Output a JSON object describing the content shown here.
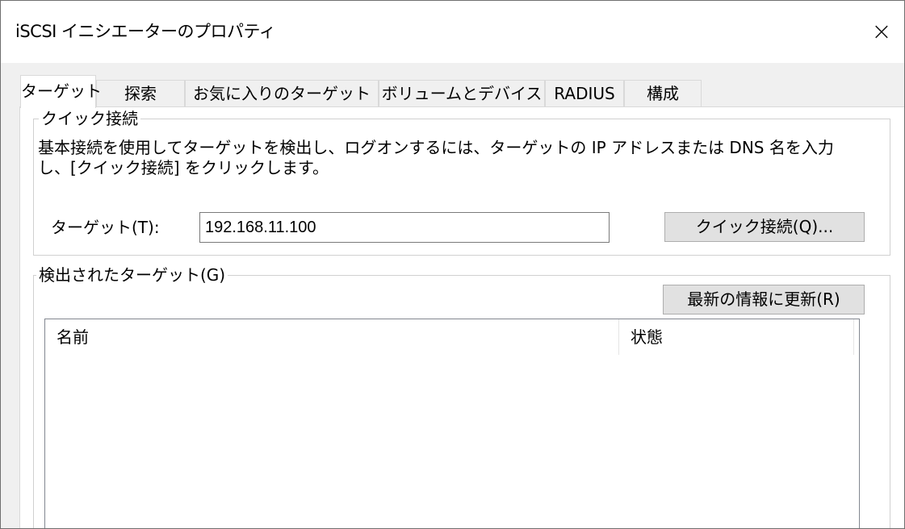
{
  "window": {
    "title": "iSCSI イニシエーターのプロパティ",
    "close_label": "×"
  },
  "tabs": [
    {
      "label": "ターゲット",
      "active": true
    },
    {
      "label": "探索",
      "active": false
    },
    {
      "label": "お気に入りのターゲット",
      "active": false
    },
    {
      "label": "ボリュームとデバイス",
      "active": false
    },
    {
      "label": "RADIUS",
      "active": false
    },
    {
      "label": "構成",
      "active": false
    }
  ],
  "quick_connect": {
    "legend": "クイック接続",
    "description": "基本接続を使用してターゲットを検出し、ログオンするには、ターゲットの IP アドレスまたは DNS 名を入力\nし、[クイック接続] をクリックします。",
    "target_label": "ターゲット(T):",
    "target_value": "192.168.11.100",
    "button_label": "クイック接続(Q)..."
  },
  "discovered_targets": {
    "legend": "検出されたターゲット(G)",
    "refresh_button": "最新の情報に更新(R)",
    "columns": [
      "名前",
      "状態"
    ],
    "rows": []
  }
}
